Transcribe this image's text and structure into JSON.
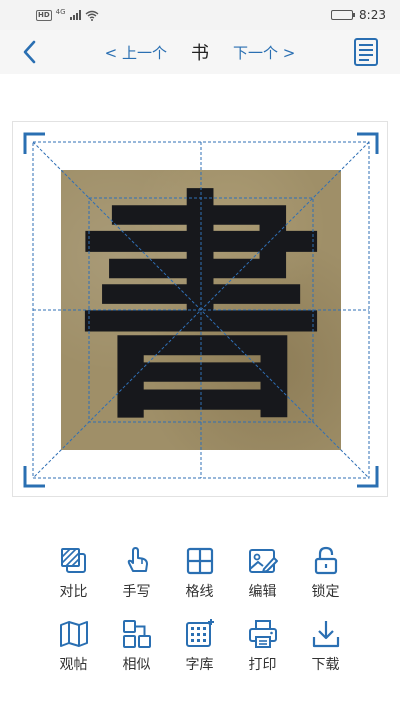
{
  "status": {
    "hd": "HD",
    "network": "4G",
    "time": "8:23",
    "battery_level": 0.85
  },
  "nav": {
    "prev_label": "< 上一个",
    "title": "书",
    "next_label": "下一个 >"
  },
  "preview": {
    "character": "書"
  },
  "toolbar": [
    {
      "label": "对比",
      "icon": "compare-icon"
    },
    {
      "label": "手写",
      "icon": "handwrite-icon"
    },
    {
      "label": "格线",
      "icon": "grid-lines-icon"
    },
    {
      "label": "编辑",
      "icon": "edit-image-icon"
    },
    {
      "label": "锁定",
      "icon": "unlock-icon"
    },
    {
      "label": "观帖",
      "icon": "map-view-icon"
    },
    {
      "label": "相似",
      "icon": "similar-icon"
    },
    {
      "label": "字库",
      "icon": "font-library-icon"
    },
    {
      "label": "打印",
      "icon": "print-icon"
    },
    {
      "label": "下载",
      "icon": "download-icon"
    }
  ],
  "colors": {
    "accent": "#2a6fb2",
    "grid_line": "#2f6fb5",
    "paper": "#9f8f68"
  }
}
